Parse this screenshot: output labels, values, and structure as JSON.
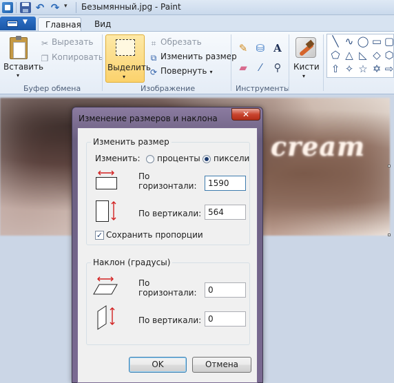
{
  "window": {
    "title": "Безымянный.jpg - Paint"
  },
  "quick_access": {
    "icons": [
      "paint-app-icon",
      "save-icon",
      "undo-icon",
      "redo-icon",
      "customize-dropdown-icon"
    ]
  },
  "tabs": {
    "file_icon": "paint-menu-icon",
    "home": "Главная",
    "view": "Вид"
  },
  "ribbon": {
    "clipboard": {
      "paste": "Вставить",
      "cut": "Вырезать",
      "copy": "Копировать",
      "group": "Буфер обмена"
    },
    "image": {
      "select": "Выделить",
      "crop": "Обрезать",
      "resize": "Изменить размер",
      "rotate": "Повернуть",
      "group": "Изображение"
    },
    "tools": {
      "group": "Инструменты",
      "icons": [
        "pencil-icon",
        "fill-icon",
        "text-icon",
        "eraser-icon",
        "color-picker-icon",
        "magnifier-icon"
      ]
    },
    "brushes": {
      "label": "Кисти"
    },
    "shapes": {
      "icons": [
        "line",
        "curve",
        "oval",
        "rectangle",
        "rounded-rectangle",
        "polygon",
        "triangle",
        "right-triangle",
        "diamond",
        "pentagon",
        "hexagon",
        "right-arrow",
        "left-arrow",
        "up-arrow",
        "down-arrow",
        "four-point-star",
        "five-point-star",
        "six-point-star"
      ]
    }
  },
  "canvas": {
    "overlay_text": "cream"
  },
  "dialog": {
    "title": "Изменение размеров и наклона",
    "close": "✕",
    "resize": {
      "legend": "Изменить размер",
      "by_label": "Изменить:",
      "percent": "проценты",
      "pixels": "пиксели",
      "selected_unit": "пиксели",
      "horizontal_label_1": "По",
      "horizontal_label_2": "горизонтали:",
      "horizontal_value": "1590",
      "vertical_label": "По вертикали:",
      "vertical_value": "564",
      "keep_ratio": "Сохранить пропорции",
      "keep_ratio_checked": true
    },
    "skew": {
      "legend": "Наклон (градусы)",
      "horizontal_label_1": "По",
      "horizontal_label_2": "горизонтали:",
      "horizontal_value": "0",
      "vertical_label": "По вертикали:",
      "vertical_value": "0"
    },
    "ok": "OK",
    "cancel": "Отмена"
  },
  "colors": {
    "arrow_red": "#d21f1f",
    "select_highlight": "#fbd26c",
    "title_close": "#c9452f"
  }
}
